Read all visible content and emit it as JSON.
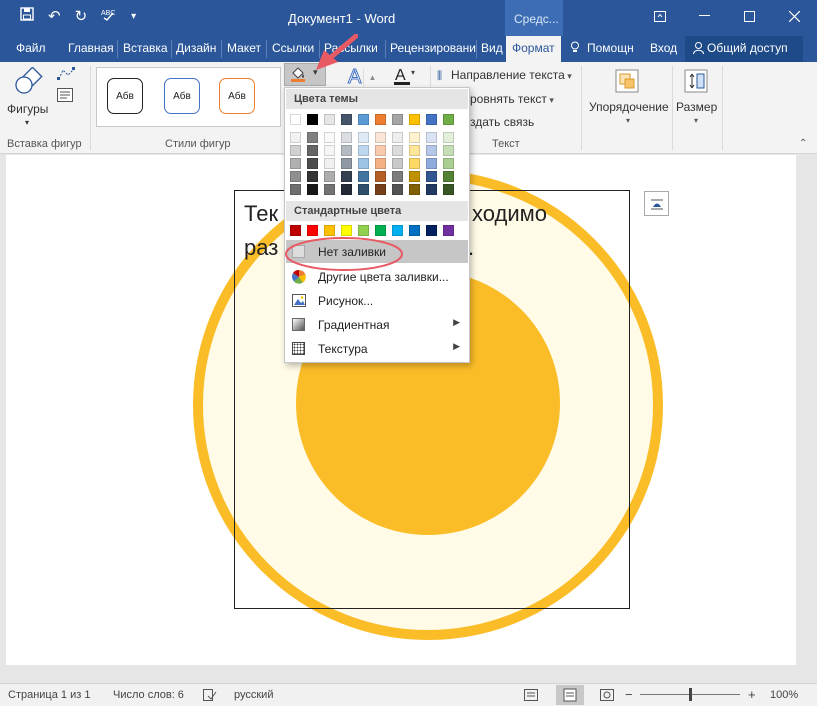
{
  "window": {
    "title": "Документ1 - Word",
    "context_group": "Средс...",
    "controls": [
      "—",
      "▢",
      "✕",
      "▭"
    ]
  },
  "qat": {
    "save_icon": "save-icon",
    "undo_icon": "undo-icon",
    "redo_icon": "redo-icon",
    "spell_icon": "spellcheck-icon",
    "customize_icon": "chevron-down-icon"
  },
  "tabs": [
    {
      "label": "Файл"
    },
    {
      "label": "Главная"
    },
    {
      "label": "Вставка"
    },
    {
      "label": "Дизайн"
    },
    {
      "label": "Макет"
    },
    {
      "label": "Ссылки"
    },
    {
      "label": "Рассылки"
    },
    {
      "label": "Рецензировани"
    },
    {
      "label": "Вид"
    },
    {
      "label": "Формат"
    },
    {
      "label": "Помощн"
    },
    {
      "label": "Вход"
    }
  ],
  "share_label": "Общий доступ",
  "ribbon": {
    "insert_shapes": {
      "shapes_label": "Фигуры",
      "group_label": "Вставка фигур"
    },
    "shape_styles": {
      "group_label": "Стили фигур",
      "cards": [
        {
          "text": "Абв",
          "border": "#222222"
        },
        {
          "text": "Абв",
          "border": "#4472c4"
        },
        {
          "text": "Абв",
          "border": "#ed7d31"
        }
      ]
    },
    "text": {
      "group_label": "Текст",
      "direction": "Направление текста",
      "align": "ровнять текст",
      "link": "здать связь"
    },
    "arrange": {
      "label": "Упорядочение"
    },
    "size": {
      "label": "Размер"
    }
  },
  "document": {
    "line1": "Текст, который необходимо",
    "line1_left": "Тек",
    "line1_right": "ходимо",
    "line2_left": "раз",
    "line2_right": "."
  },
  "dropdown": {
    "theme_header": "Цвета темы",
    "standard_header": "Стандартные цвета",
    "theme_colors": [
      "#ffffff",
      "#000000",
      "#e7e6e6",
      "#44546a",
      "#5b9bd5",
      "#ed7d31",
      "#a5a5a5",
      "#ffc000",
      "#4472c4",
      "#70ad47"
    ],
    "standard_colors": [
      "#c00000",
      "#ff0000",
      "#ffc000",
      "#ffff00",
      "#92d050",
      "#00b050",
      "#00b0f0",
      "#0070c0",
      "#002060",
      "#7030a0"
    ],
    "items": [
      {
        "label": "Нет заливки",
        "icon": "no-fill-icon"
      },
      {
        "label": "Другие цвета заливки...",
        "icon": "color-wheel-icon"
      },
      {
        "label": "Рисунок...",
        "icon": "picture-icon"
      },
      {
        "label": "Градиентная",
        "icon": "gradient-icon",
        "submenu": "▶"
      },
      {
        "label": "Текстура",
        "icon": "texture-icon",
        "submenu": "▶"
      }
    ]
  },
  "status": {
    "page": "Страница 1 из 1",
    "words": "Число слов: 6",
    "lang": "русский",
    "zoom": "100%"
  },
  "colors": {
    "accent": "#2b579a",
    "circle_ring": "#fbbd27",
    "circle_fill": "#fffbe6",
    "circle_inner": "#fbbd27",
    "annotation": "#e85a63"
  }
}
